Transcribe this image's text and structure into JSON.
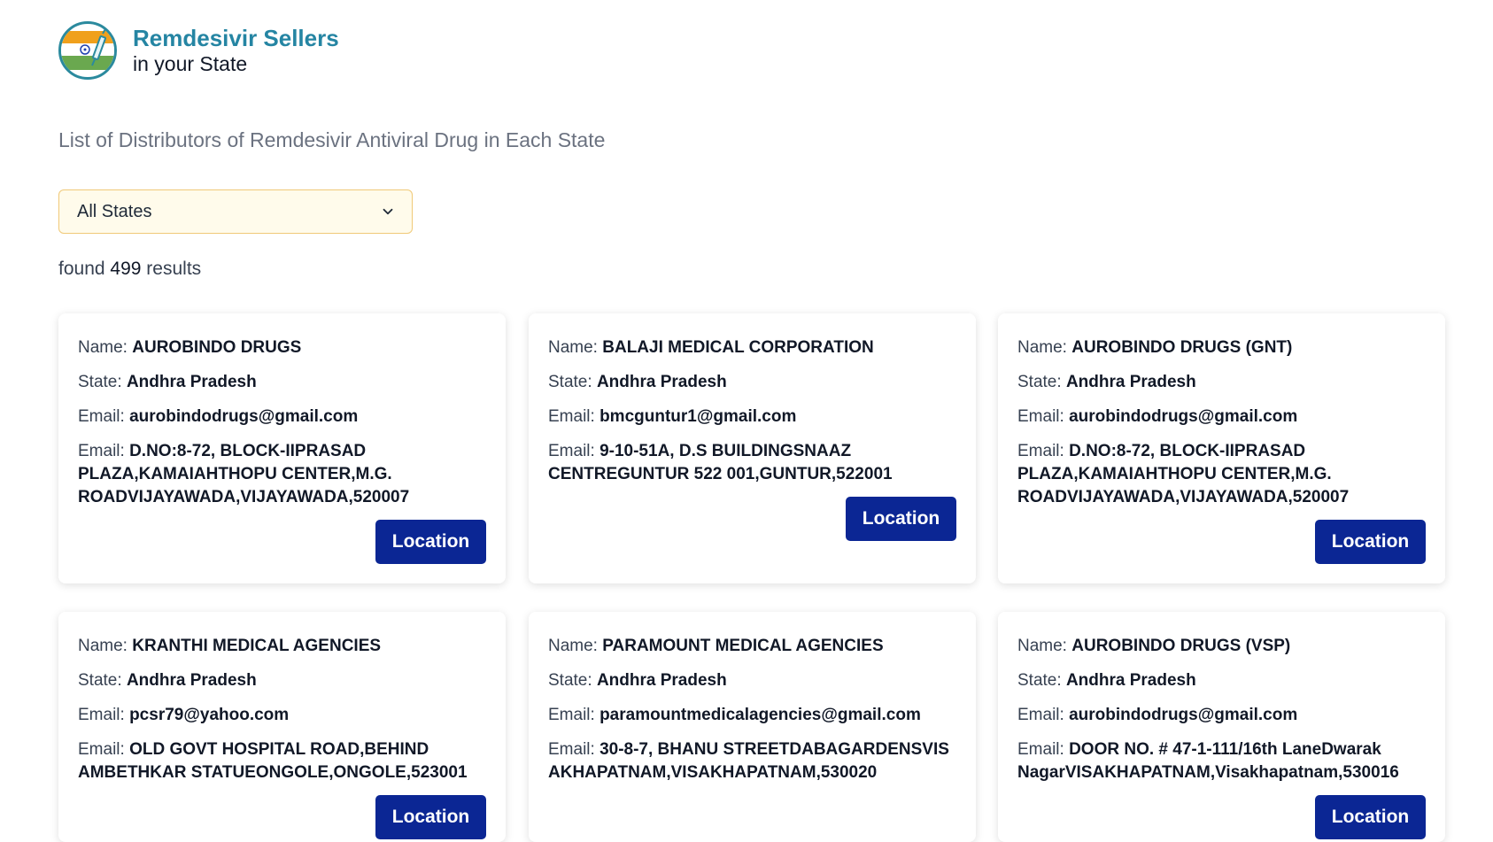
{
  "header": {
    "title": "Remdesivir Sellers",
    "subtitle": "in your State"
  },
  "page": {
    "subtitle": "List of Distributors of Remdesivir Antiviral Drug in Each State"
  },
  "filter": {
    "selected": "All States"
  },
  "results": {
    "prefix": "found",
    "count": "499",
    "suffix": "results"
  },
  "labels": {
    "name": "Name:",
    "state": "State:",
    "email": "Email:",
    "address": "Email:",
    "location_button": "Location"
  },
  "cards": [
    {
      "name": "AUROBINDO DRUGS",
      "state": "Andhra Pradesh",
      "email": "aurobindodrugs@gmail.com",
      "address": "D.NO:8-72, BLOCK-IIPRASAD PLAZA,KAMAIAHTHOPU CENTER,M.G. ROADVIJAYAWADA,VIJAYAWADA,520007"
    },
    {
      "name": "BALAJI MEDICAL CORPORATION",
      "state": "Andhra Pradesh",
      "email": "bmcguntur1@gmail.com",
      "address": "9-10-51A, D.S BUILDINGSNAAZ CENTREGUNTUR 522 001,GUNTUR,522001"
    },
    {
      "name": "AUROBINDO DRUGS (GNT)",
      "state": "Andhra Pradesh",
      "email": "aurobindodrugs@gmail.com",
      "address": "D.NO:8-72, BLOCK-IIPRASAD PLAZA,KAMAIAHTHOPU CENTER,M.G. ROADVIJAYAWADA,VIJAYAWADA,520007"
    },
    {
      "name": "KRANTHI MEDICAL AGENCIES",
      "state": "Andhra Pradesh",
      "email": "pcsr79@yahoo.com",
      "address": "OLD GOVT HOSPITAL ROAD,BEHIND AMBETHKAR STATUEONGOLE,ONGOLE,523001"
    },
    {
      "name": "PARAMOUNT MEDICAL AGENCIES",
      "state": "Andhra Pradesh",
      "email": "paramountmedicalagencies@gmail.com",
      "address": "30-8-7, BHANU STREETDABAGARDENSVISAKHAPATNAM,VISAKHAPATNAM,530020"
    },
    {
      "name": "AUROBINDO DRUGS (VSP)",
      "state": "Andhra Pradesh",
      "email": "aurobindodrugs@gmail.com",
      "address": "DOOR NO. # 47-1-111/16th LaneDwarak NagarVISAKHAPATNAM,Visakhapatnam,530016"
    }
  ]
}
